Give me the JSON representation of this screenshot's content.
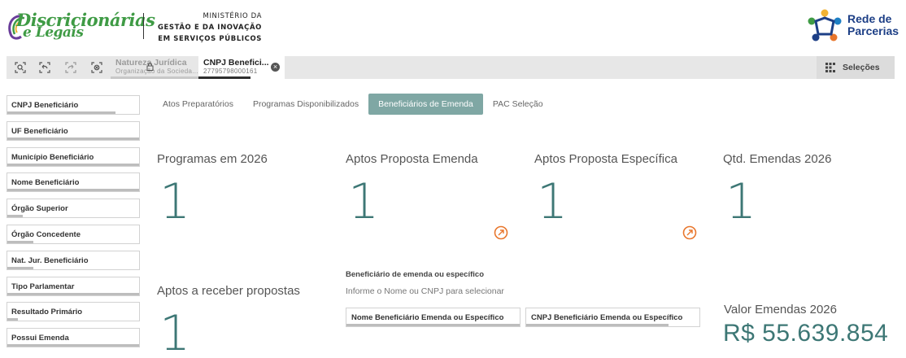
{
  "header": {
    "brand_line1": "Discricionárias",
    "brand_line2": "e Legais",
    "ministry_line1": "MINISTÉRIO DA",
    "ministry_line2": "GESTÃO E DA INOVAÇÃO",
    "ministry_line3": "EM SERVIÇOS PÚBLICOS",
    "partner_line1": "Rede de",
    "partner_line2": "Parcerias"
  },
  "toolbar": {
    "tools": [
      "smart-search-icon",
      "step-back-icon",
      "step-forward-icon",
      "clear-selections-icon"
    ],
    "chips": [
      {
        "title": "Natureza Jurídica",
        "subtitle": "Organização da Socieda..."
      },
      {
        "title": "CNPJ Benefici...",
        "subtitle": "27795798000161"
      }
    ],
    "selections_label": "Seleções"
  },
  "filters": [
    {
      "label": "CNPJ Beneficiário",
      "fill": 0.82
    },
    {
      "label": "UF Beneficiário",
      "fill": 1.0
    },
    {
      "label": "Município Beneficiário",
      "fill": 1.0
    },
    {
      "label": "Nome Beneficiário",
      "fill": 1.0
    },
    {
      "label": "Órgão Superior",
      "fill": 0.12
    },
    {
      "label": "Órgão Concedente",
      "fill": 0.2
    },
    {
      "label": "Nat. Jur. Beneficiário",
      "fill": 0.2
    },
    {
      "label": "Tipo Parlamentar",
      "fill": 1.0
    },
    {
      "label": "Resultado Primário",
      "fill": 0.08
    },
    {
      "label": "Possui Emenda",
      "fill": 1.0
    }
  ],
  "tabs": [
    {
      "label": "Atos Preparatórios",
      "active": false
    },
    {
      "label": "Programas Disponibilizados",
      "active": false
    },
    {
      "label": "Beneficiários de Emenda",
      "active": true
    },
    {
      "label": "PAC Seleção",
      "active": false
    }
  ],
  "kpis": {
    "programas": {
      "title": "Programas em 2026",
      "value": "1"
    },
    "aptos_emenda": {
      "title": "Aptos Proposta Emenda",
      "value": "1"
    },
    "aptos_especifica": {
      "title": "Aptos Proposta Específica",
      "value": "1"
    },
    "qtd_emendas": {
      "title": "Qtd. Emendas 2026",
      "value": "1"
    },
    "aptos_receber": {
      "title": "Aptos a receber propostas",
      "value": "1"
    }
  },
  "beneficiario": {
    "title": "Beneficiário de emenda ou específico",
    "hint": "Informe o Nome ou CNPJ para selecionar",
    "nome_label": "Nome Beneficiário Emenda ou Específico",
    "nome_fill": 1.0,
    "cnpj_label": "CNPJ Beneficiário Emenda ou Específico",
    "cnpj_fill": 0.82
  },
  "valor": {
    "title": "Valor Emendas 2026",
    "value": "R$ 55.639.854"
  },
  "colors": {
    "accent": "#3d7775",
    "active_tab": "#7fa7a4",
    "brand_green": "#3f9b45",
    "partner_blue": "#1d3f86",
    "link_orange": "#e8762c"
  }
}
